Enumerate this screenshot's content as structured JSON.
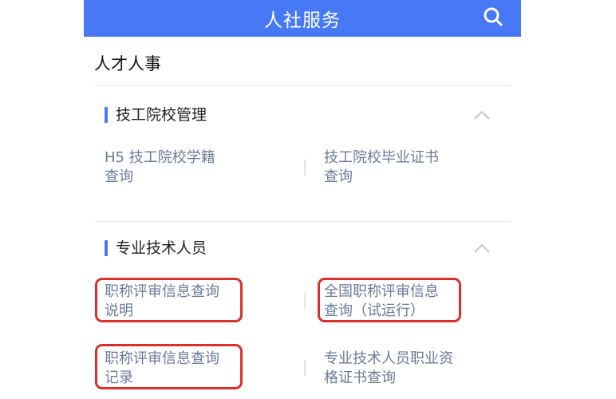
{
  "header": {
    "title": "人社服务"
  },
  "section": {
    "title": "人才人事"
  },
  "groups": [
    {
      "label": "技工院校管理",
      "items": [
        {
          "line1": "H5 技工院校学籍",
          "line2": "查询"
        },
        {
          "line1": "技工院校毕业证书",
          "line2": "查询"
        }
      ]
    },
    {
      "label": "专业技术人员",
      "items": [
        {
          "line1": "职称评审信息查询",
          "line2": "说明"
        },
        {
          "line1": "全国职称评审信息",
          "line2": "查询（试运行）"
        },
        {
          "line1": "职称评审信息查询",
          "line2": "记录"
        },
        {
          "line1": "专业技术人员职业资",
          "line2": "格证书查询"
        }
      ]
    }
  ],
  "colors": {
    "header_bg": "#4778f5",
    "accent": "#4778f5",
    "item_text": "#6b7a99",
    "highlight": "#d9302b"
  },
  "icons": {
    "search": "search-icon",
    "collapse": "chevron-up-icon"
  }
}
